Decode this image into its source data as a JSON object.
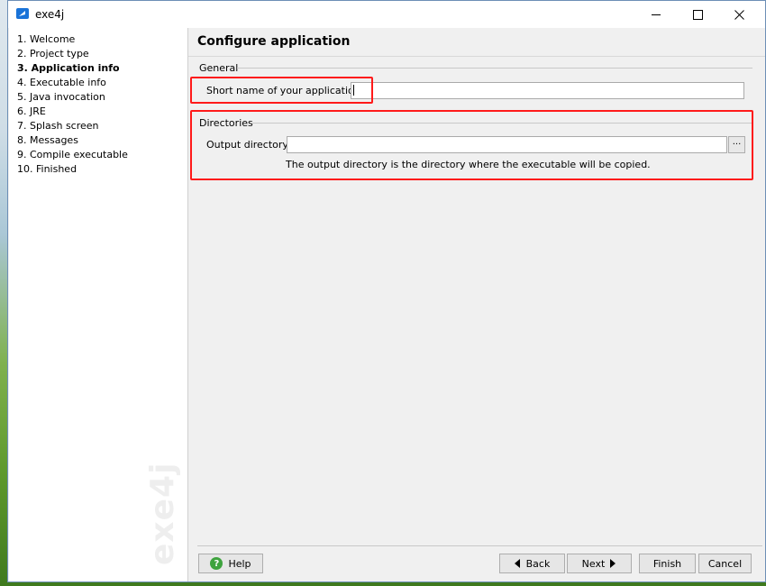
{
  "window": {
    "title": "exe4j",
    "icon": "exe4j-app-icon"
  },
  "titlebar_buttons": {
    "minimize": "minimize-icon",
    "maximize": "maximize-icon",
    "close": "close-icon"
  },
  "sidebar": {
    "steps": [
      {
        "label": "1. Welcome",
        "active": false
      },
      {
        "label": "2. Project type",
        "active": false
      },
      {
        "label": "3. Application info",
        "active": true
      },
      {
        "label": "4. Executable info",
        "active": false
      },
      {
        "label": "5. Java invocation",
        "active": false
      },
      {
        "label": "6. JRE",
        "active": false
      },
      {
        "label": "7. Splash screen",
        "active": false
      },
      {
        "label": "8. Messages",
        "active": false
      },
      {
        "label": "9. Compile executable",
        "active": false
      },
      {
        "label": "10. Finished",
        "active": false
      }
    ],
    "watermark": "exe4j"
  },
  "page": {
    "title": "Configure application"
  },
  "general": {
    "title": "General",
    "short_name_label": "Short name of your application:",
    "short_name_value": ""
  },
  "directories": {
    "title": "Directories",
    "output_dir_label": "Output directory:",
    "output_dir_value": "",
    "browse_label": "...",
    "hint": "The output directory is the directory where the executable will be copied."
  },
  "buttons": {
    "help": "Help",
    "back": "Back",
    "next": "Next",
    "finish": "Finish",
    "cancel": "Cancel"
  },
  "colors": {
    "highlight": "#ff1a1a",
    "help_icon": "#3ea33e",
    "window_border": "#6d8fb6"
  }
}
